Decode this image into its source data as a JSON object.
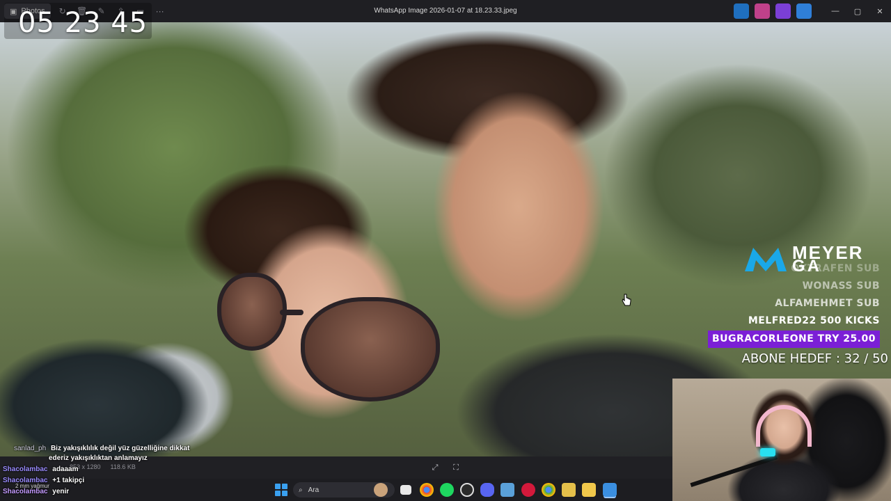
{
  "titlebar": {
    "tab_label": "Photos",
    "title": "WhatsApp Image 2026-01-07 at 18.23.33.jpeg",
    "more_label": "···",
    "window_controls": {
      "minimize": "—",
      "maximize": "▢",
      "close": "✕"
    }
  },
  "overlay": {
    "clock": "05 23 45"
  },
  "sponsor": {
    "logo_line1": "MEYER",
    "logo_line2": "GA",
    "rows": [
      "OKTRAFEN SUB",
      "WONASS SUB",
      "ALFAMEHMET SUB",
      "MELFRED22 500 KICKS",
      "BUGRACORLEONE TRY 25.00"
    ],
    "goal": "ABONE HEDEF : 32 / 50"
  },
  "viewer": {
    "dimensions": "853 x 1280",
    "size": "118.6 KB"
  },
  "taskbar": {
    "search_placeholder": "Ara",
    "weather": "2 mm yağmur"
  },
  "chat": {
    "messages": [
      {
        "user": "sanlad_ph",
        "text": "Biz yakışıklılık değil yüz güzelliğine dikkat"
      },
      {
        "user": "",
        "text": "ederiz yakışıklıktan anlamayız"
      },
      {
        "user": "Shacolambac",
        "text": "adaaam"
      },
      {
        "user": "Shacolambac",
        "text": "+1 takipçi"
      },
      {
        "user": "Shacolambac",
        "text": "yenir"
      }
    ]
  },
  "colors": {
    "highlight": "#7b1fd6",
    "logo_blue": "#1aa8e8",
    "mic_light": "#28e0f0"
  }
}
